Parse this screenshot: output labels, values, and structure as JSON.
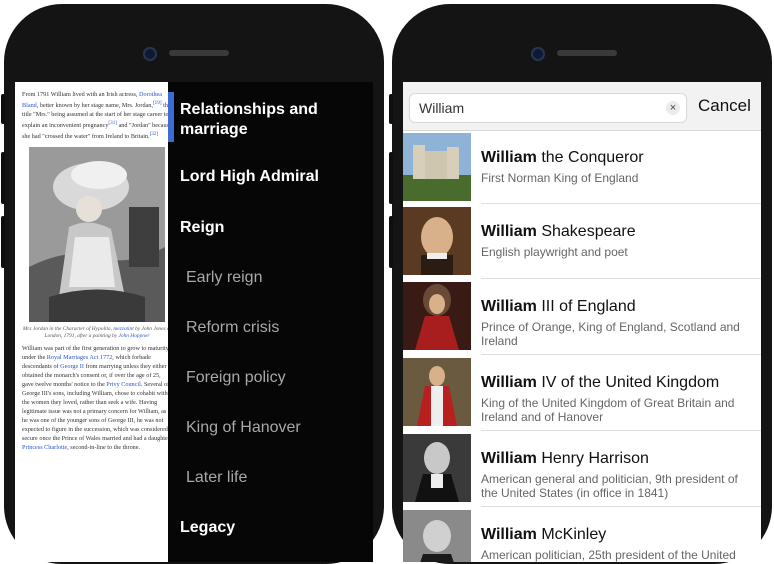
{
  "left_screen": {
    "article": {
      "para1_a": "From 1791 William lived with an Irish actress, ",
      "para1_link1": "Dorothea Bland",
      "para1_b": ", better known by her stage name, Mrs. Jordan,",
      "para1_ref1": "[19]",
      "para1_c": " the title \"Mrs.\" being assumed at the start of her stage career to explain an inconvenient pregnancy",
      "para1_ref2": "[31]",
      "para1_d": " and \"Jordan\" because she had \"crossed the water\" from Ireland to Britain.",
      "para1_ref3": "[32]",
      "caption_a": "Mrs Jordan in the Character of Hypolita, ",
      "caption_link1": "mezzotint",
      "caption_b": " by John Jones of London, 1791, after a painting by ",
      "caption_link2": "John Hoppner",
      "para2_a": "William was part of the first generation to grow to maturity under the ",
      "para2_link1": "Royal Marriages Act 1772",
      "para2_b": ", which forbade descendants of ",
      "para2_link2": "George II",
      "para2_c": " from marrying unless they either obtained the monarch's consent or, if over the age of 25, gave twelve months' notice to the ",
      "para2_link3": "Privy Council",
      "para2_d": ". Several of George III's sons, including William, chose to cohabit with the women they loved, rather than seek a wife. Having legitimate issue was not a primary concern for William, as he was one of the younger sons of George III, he was not expected to figure in the succession, which was considered secure once the Prince of Wales married and had a daughter, ",
      "para2_link4": "Princess Charlotte",
      "para2_e": ", second-in-line to the throne."
    },
    "toc": [
      {
        "label": "Relationships and marriage",
        "level": 1,
        "active": true
      },
      {
        "label": "Lord High Admiral",
        "level": 1
      },
      {
        "label": "Reign",
        "level": 1
      },
      {
        "label": "Early reign",
        "level": 2
      },
      {
        "label": "Reform crisis",
        "level": 2
      },
      {
        "label": "Foreign policy",
        "level": 2
      },
      {
        "label": "King of Hanover",
        "level": 2
      },
      {
        "label": "Later life",
        "level": 2
      },
      {
        "label": "Legacy",
        "level": 1
      }
    ]
  },
  "right_screen": {
    "search": {
      "value": "William",
      "cancel_label": "Cancel",
      "clear_icon": "×"
    },
    "results": [
      {
        "bold": "William",
        "rest": " the Conqueror",
        "desc": "First Norman King of England"
      },
      {
        "bold": "William",
        "rest": " Shakespeare",
        "desc": "English playwright and poet"
      },
      {
        "bold": "William",
        "rest": " III of England",
        "desc": "Prince of Orange, King of England, Scotland and Ireland"
      },
      {
        "bold": "William",
        "rest": " IV of the United Kingdom",
        "desc": "King of the United Kingdom of Great Britain and Ireland and of Hanover"
      },
      {
        "bold": "William",
        "rest": " Henry Harrison",
        "desc": "American general and politician, 9th president of the United States (in office in 1841)"
      },
      {
        "bold": "William",
        "rest": " McKinley",
        "desc": "American politician, 25th president of the United"
      }
    ]
  },
  "colors": {
    "link": "#2a57c7",
    "toc_active": "#3c6bd6",
    "toc_bg": "#060606",
    "phone_body": "#141414"
  }
}
